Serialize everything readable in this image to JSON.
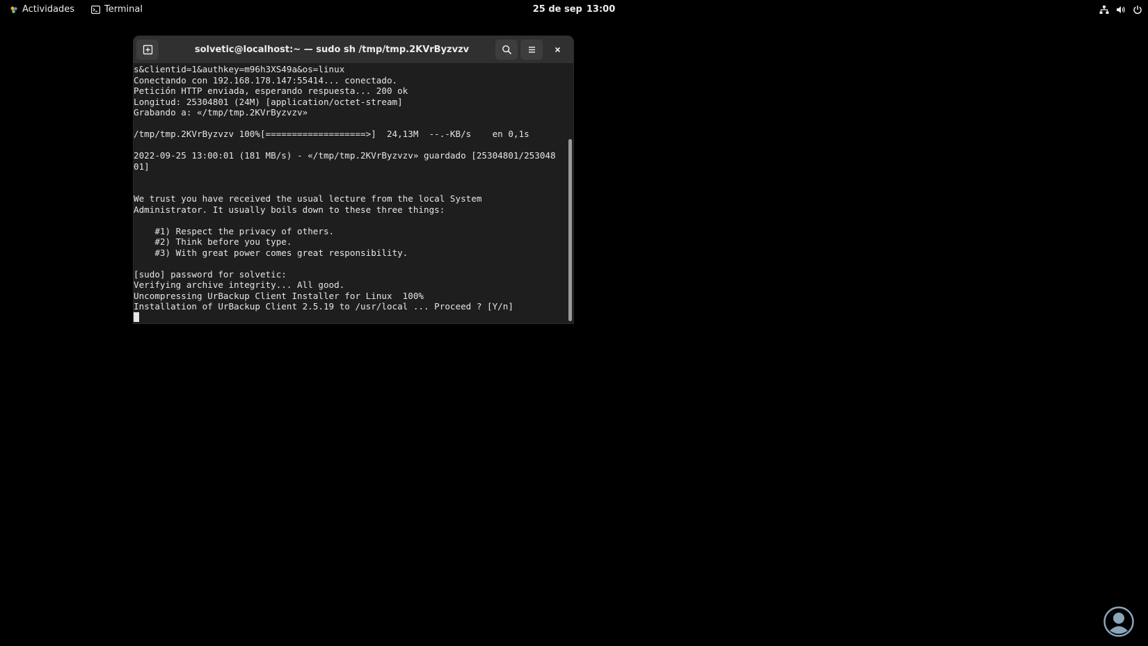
{
  "topbar": {
    "activities_label": "Actividades",
    "app_label": "Terminal",
    "date": "25 de sep",
    "time": "13:00",
    "tray_icons": [
      "network-icon",
      "volume-icon",
      "power-icon"
    ]
  },
  "window": {
    "title": "solvetic@localhost:~ — sudo sh /tmp/tmp.2KVrByzvzv",
    "buttons": [
      "new-tab-icon",
      "search-icon",
      "hamburger-menu-icon",
      "close-icon"
    ]
  },
  "terminal": {
    "lines": [
      "s&clientid=1&authkey=m96h3XS49a&os=linux",
      "Conectando con 192.168.178.147:55414... conectado.",
      "Petición HTTP enviada, esperando respuesta... 200 ok",
      "Longitud: 25304801 (24M) [application/octet-stream]",
      "Grabando a: «/tmp/tmp.2KVrByzvzv»",
      "",
      "/tmp/tmp.2KVrByzvzv 100%[===================>]  24,13M  --.-KB/s    en 0,1s",
      "",
      "2022-09-25 13:00:01 (181 MB/s) - «/tmp/tmp.2KVrByzvzv» guardado [25304801/253048",
      "01]",
      "",
      "",
      "We trust you have received the usual lecture from the local System",
      "Administrator. It usually boils down to these three things:",
      "",
      "    #1) Respect the privacy of others.",
      "    #2) Think before you type.",
      "    #3) With great power comes great responsibility.",
      "",
      "[sudo] password for solvetic:",
      "Verifying archive integrity... All good.",
      "Uncompressing UrBackup Client Installer for Linux  100%",
      "Installation of UrBackup Client 2.5.19 to /usr/local ... Proceed ? [Y/n]"
    ]
  },
  "colors": {
    "desktop_bg": "#000000",
    "headerbar_bg": "#303030",
    "terminal_bg": "#1e1e1e",
    "terminal_fg": "#e6e6e6",
    "watermark": "#8aa6ba"
  }
}
